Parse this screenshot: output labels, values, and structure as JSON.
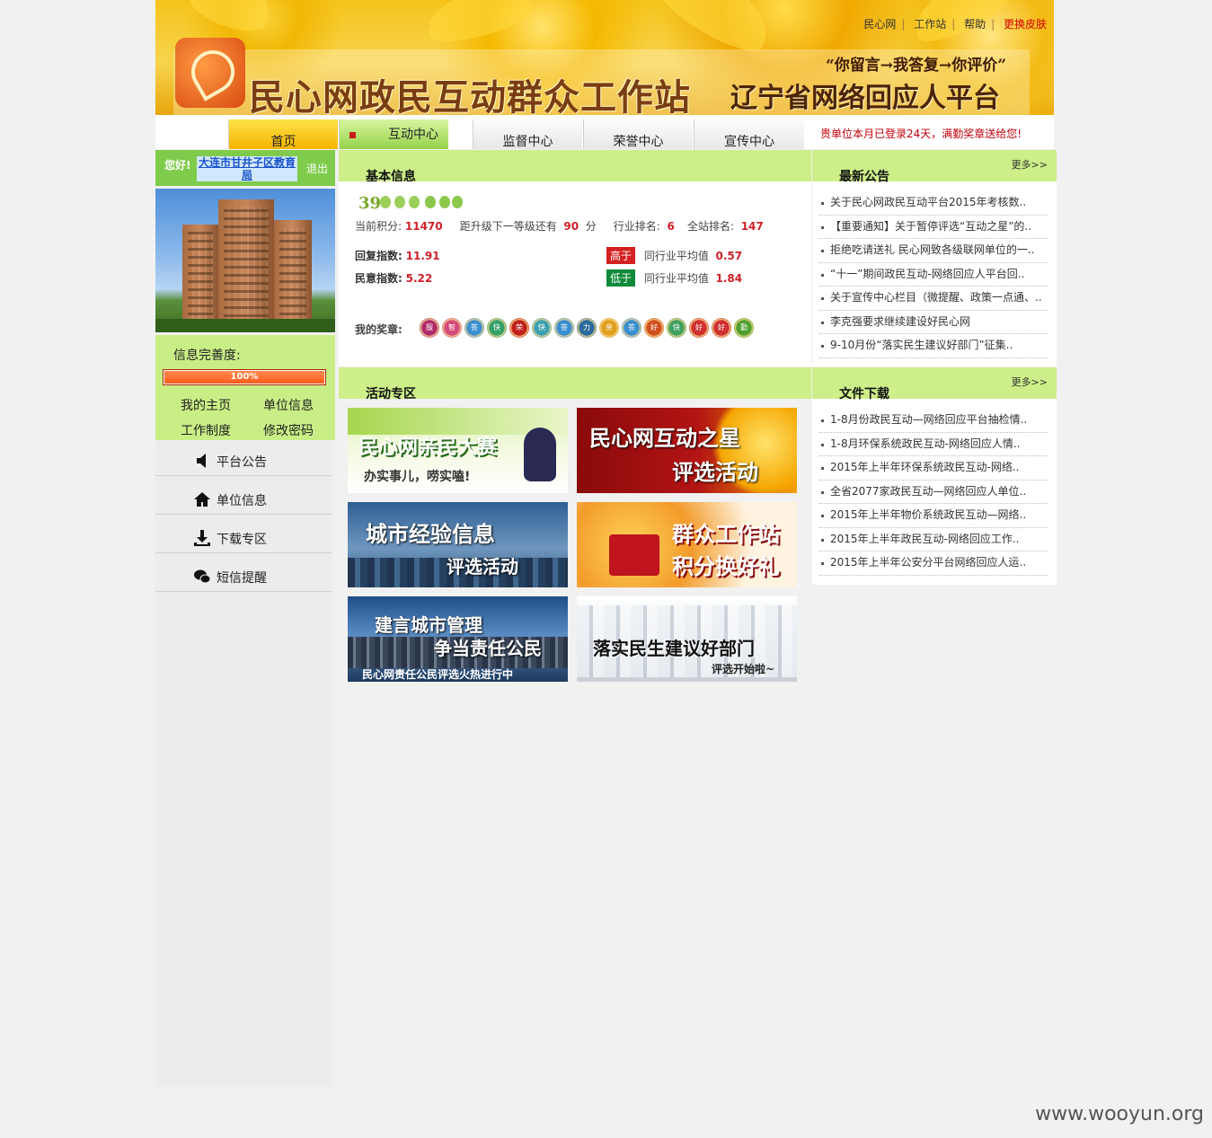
{
  "header": {
    "site_title": "民心网政民互动群众工作站",
    "slogan": "“你留言→我答复→你评价”",
    "subtitle": "辽宁省网络回应人平台",
    "top_links": [
      "民心网",
      "工作站",
      "帮助",
      "更换皮肤"
    ]
  },
  "nav": {
    "tabs": [
      "首页",
      "互动中心",
      "监督中心",
      "荣誉中心",
      "宣传中心"
    ],
    "active_tab": "互动中心",
    "notice": "贵单位本月已登录24天，满勤奖章送给您!"
  },
  "user": {
    "greeting": "您好!",
    "unit_name": "大连市甘井子区教育局",
    "logout": "退出"
  },
  "profile": {
    "completion_label": "信息完善度:",
    "completion_value": 1.0,
    "completion_text": "100%",
    "links": [
      "我的主页",
      "单位信息",
      "工作制度",
      "修改密码"
    ]
  },
  "side_menu": [
    {
      "label": "平台公告",
      "icon": "speaker-icon"
    },
    {
      "label": "单位信息",
      "icon": "home-icon"
    },
    {
      "label": "下载专区",
      "icon": "download-icon"
    },
    {
      "label": "短信提醒",
      "icon": "chat-icon"
    }
  ],
  "basic_info": {
    "title": "基本信息",
    "level": "39",
    "points_label": "当前积分:",
    "points": "11470",
    "next_level_label": "距升级下一等级还有",
    "next_level": "90",
    "next_level_unit": "分",
    "industry_rank_label": "行业排名:",
    "industry_rank": "6",
    "overall_rank_label": "全站排名:",
    "overall_rank": "147",
    "reply_index_label": "回复指数:",
    "reply_index": "11.91",
    "reply_compare_tag": "高于",
    "reply_avg_label": "同行业平均值",
    "reply_avg": "0.57",
    "opinion_index_label": "民意指数:",
    "opinion_index": "5.22",
    "opinion_compare_tag": "低于",
    "opinion_avg_label": "同行业平均值",
    "opinion_avg": "1.84",
    "medals_label": "我的奖章:",
    "medals": [
      "服",
      "智",
      "答",
      "快",
      "荣",
      "快",
      "答",
      "力",
      "亲",
      "答",
      "好",
      "快",
      "好",
      "好",
      "勤"
    ]
  },
  "activities": {
    "title": "活动专区",
    "items": [
      {
        "line1": "民心网亲民大赛",
        "line2": "办实事儿，唠实嗑!"
      },
      {
        "line1": "民心网互动之星",
        "line2": "评选活动"
      },
      {
        "line1": "城市经验信息",
        "line2": "评选活动"
      },
      {
        "line1": "群众工作站",
        "line2": "积分换好礼"
      },
      {
        "line1": "建言城市管理",
        "line2": "争当责任公民",
        "line3": "民心网责任公民评选火热进行中"
      },
      {
        "line1": "落实民生建议好部门",
        "line2": "评选开始啦~"
      }
    ]
  },
  "announcements": {
    "title": "最新公告",
    "more": "更多>>",
    "items": [
      "关于民心网政民互动平台2015年考核数..",
      "【重要通知】关于暂停评选“互动之星”的..",
      "拒绝吃请送礼 民心网致各级联网单位的一..",
      "“十一”期间政民互动-网络回应人平台回..",
      "关于宣传中心栏目（微提醒、政策一点通、..",
      "李克强要求继续建设好民心网",
      "9-10月份“落实民生建议好部门”征集.."
    ]
  },
  "downloads": {
    "title": "文件下载",
    "more": "更多>>",
    "items": [
      "1-8月份政民互动—网络回应平台抽检情..",
      "1-8月环保系统政民互动-网络回应人情..",
      "2015年上半年环保系统政民互动-网络..",
      "全省2077家政民互动—网络回应人单位..",
      "2015年上半年物价系统政民互动—网络..",
      "2015年上半年政民互动-网络回应工作..",
      "2015年上半年公安分平台网络回应人运.."
    ]
  },
  "watermark": "www.wooyun.org"
}
